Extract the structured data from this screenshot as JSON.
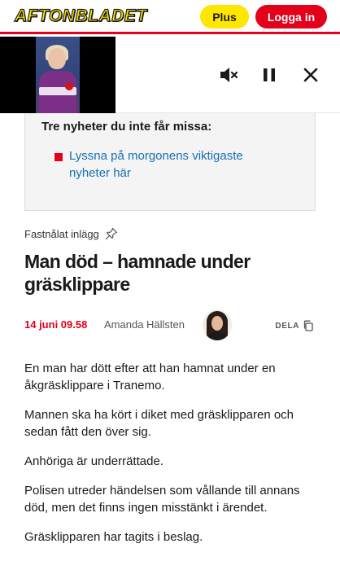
{
  "header": {
    "logo_text": "AFTONBLADET",
    "plus_label": "Plus",
    "login_label": "Logga in",
    "brand_red": "#e2001a",
    "brand_yellow": "#ffe600"
  },
  "video_player": {
    "icons": [
      "speaker-muted-icon",
      "pause-icon",
      "close-icon"
    ]
  },
  "promo": {
    "title": "Tre nyheter du inte får missa:",
    "link": "Lyssna på morgonens viktigaste nyheter här"
  },
  "article": {
    "pinned_label": "Fastnålat inlägg",
    "headline": "Man död – hamnade under gräsklippare",
    "date": "14 juni 09.58",
    "author": "Amanda Hällsten",
    "share_label": "DELA",
    "paragraphs": [
      "En man har dött efter att han hamnat under en åkgräsklippare i Tranemo.",
      "Mannen ska ha kört i diket med gräsklipparen och sedan fått den över sig.",
      "Anhöriga är underrättade.",
      "Polisen utreder händelsen som vållande till annans död, men det finns ingen misstänkt i ärendet.",
      "Gräsklipparen har tagits i beslag."
    ]
  }
}
